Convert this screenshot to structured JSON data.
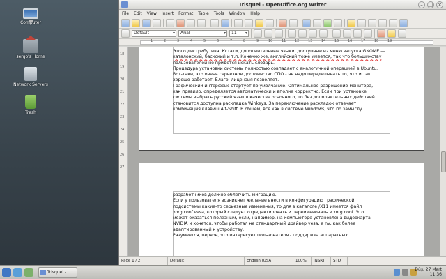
{
  "desktop": {
    "icons": [
      {
        "label": "Computer"
      },
      {
        "label": "sergo's Home"
      },
      {
        "label": "Network Servers"
      },
      {
        "label": "Trash"
      }
    ]
  },
  "window": {
    "title": "Trisquel - OpenOffice.org Writer",
    "menu": [
      "File",
      "Edit",
      "View",
      "Insert",
      "Format",
      "Table",
      "Tools",
      "Window",
      "Help"
    ],
    "format": {
      "style": "Default",
      "font": "Arial",
      "size": "11"
    },
    "ruler_ticks": [
      "1",
      "2",
      "3",
      "4",
      "5",
      "6",
      "7",
      "8",
      "9",
      "10",
      "11",
      "12",
      "13",
      "14",
      "15",
      "16",
      "17",
      "18",
      "19"
    ],
    "vruler_ticks": [
      "18",
      "19",
      "20",
      "21",
      "22",
      "23",
      "24",
      "25",
      "26",
      "27"
    ],
    "page1_lines": [
      "Этого дистрибутива. Кстати, дополнительные языки, доступные из меню запуска GNOME —",
      "каталонский, баскский и т.п. Конечно же, английский тоже имеется, так что большинству",
      "пользователей не придется искать словарь.",
      "Процедура установки системы полностью совпадает с аналогичной операцией в Ubuntu.",
      "Вот-таки, это очень серьезное достоинство СПО - не надо переделывать то, что и так",
      "хорошо работает. Благо, лицензия позволяет.",
      "Графический интерфейс стартует по умолчанию. Оптимальное разрешение монитора,",
      "как правило, определяется автоматически и вполне корректно. Если при установке",
      "системы выбрать русский язык в качестве основного, то без дополнительных действий",
      "становится доступна раскладка Winkeys. За переключение раскладок отвечает",
      "комбинация клавиш  Alt-Shift. В общем, все как в системе Windows, что по замыслу"
    ],
    "page2_lines": [
      "разработчиков должно облегчить миграцию.",
      "Если у пользователя возникнет желание внести в конфигурацию графической",
      "подсистемы какие-то серьезные изменения, то для в каталоге /X11 имеется файл",
      "xorg.conf.vesa, который следует отредактировать и переименовать в xorg.conf. Это",
      "может оказаться полезным, если, например, на компьютере установлена видеокарта",
      "NVIDIA и хочется, чтобы работал не стандартный драйвер vesa, а nv, как более",
      "адаптированный к устройству.",
      "Разумеется, первое, что интересует пользователя - поддержка аппаратных"
    ],
    "status": {
      "page": "Page 1 / 2",
      "style": "Default",
      "language": "English (USA)",
      "zoom": "100%",
      "insert": "INSRT",
      "selection": "STD"
    }
  },
  "taskbar": {
    "task_label": "Trisquel - OpenOffice...",
    "clock_date": "Düş, 27 Mart",
    "clock_time": "11:36"
  }
}
